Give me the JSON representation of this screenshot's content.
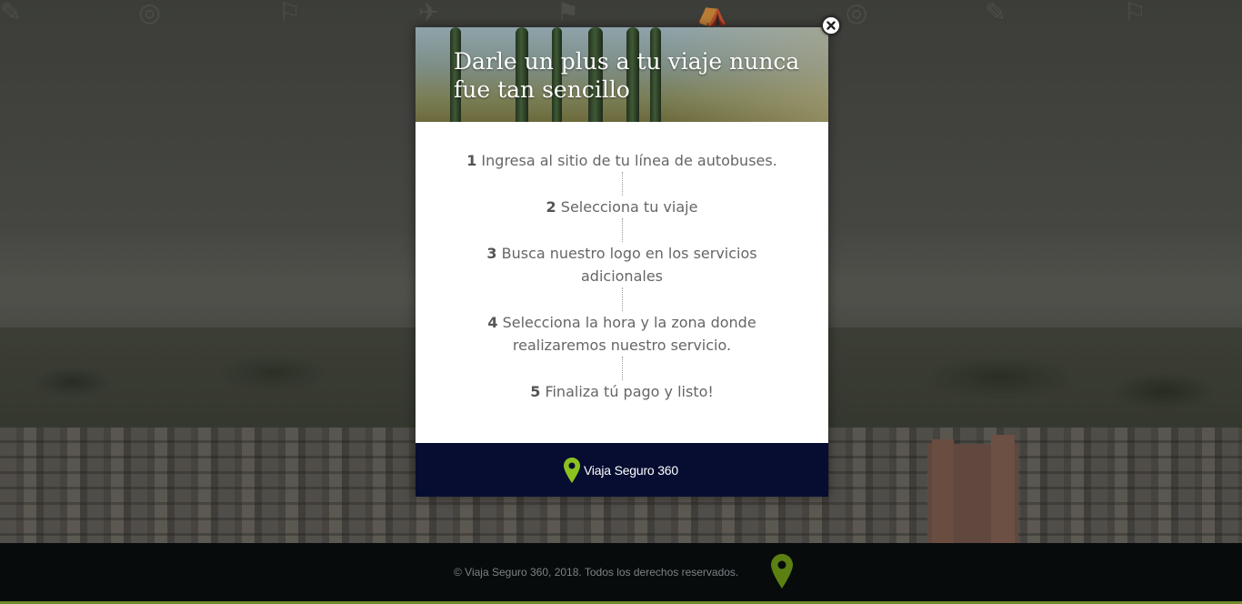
{
  "modal": {
    "title": "Darle un plus a tu viaje nunca fue tan sencillo",
    "steps": [
      {
        "number": "1",
        "text": "Ingresa al sitio de tu línea de autobuses."
      },
      {
        "number": "2",
        "text": "Selecciona tu viaje"
      },
      {
        "number": "3",
        "text": "Busca nuestro logo en los servicios adicionales"
      },
      {
        "number": "4",
        "text": "Selecciona la hora y la zona donde realizaremos nuestro servicio."
      },
      {
        "number": "5",
        "text": "Finaliza tú pago y listo!"
      }
    ],
    "brand_name": "Viaja Seguro 360",
    "close_icon": "close-icon"
  },
  "footer": {
    "copyright": "© Viaja Seguro 360, 2018. Todos los derechos reservados.",
    "pin_icon": "map-pin-icon"
  },
  "colors": {
    "modal_footer_bg": "#060d31",
    "brand_pin": "#8cc21f",
    "footer_bg": "#070b0c",
    "accent_bar": "#6f8a2a"
  }
}
